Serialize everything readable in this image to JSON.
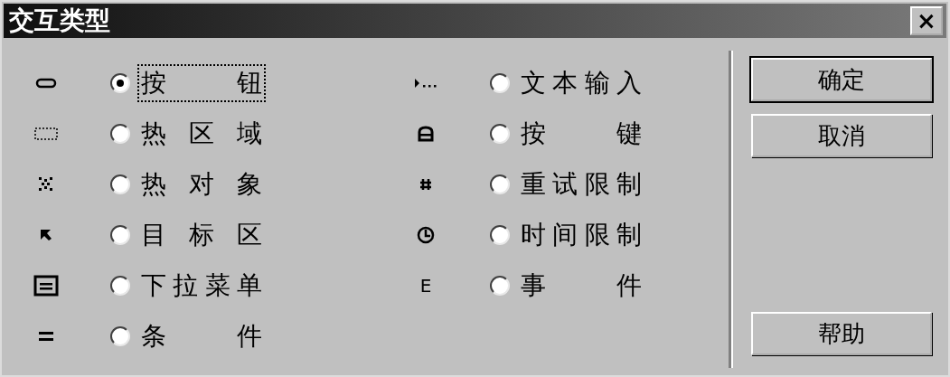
{
  "window": {
    "title": "交互类型",
    "close": "×"
  },
  "options": [
    {
      "kind": "button",
      "label": "按 钮",
      "selected": true
    },
    {
      "kind": "hotspot",
      "label": "热 区 域",
      "selected": false
    },
    {
      "kind": "hot-object",
      "label": "热 对 象",
      "selected": false
    },
    {
      "kind": "target-area",
      "label": "目 标 区",
      "selected": false
    },
    {
      "kind": "pulldown",
      "label": "下拉菜单",
      "selected": false
    },
    {
      "kind": "condition",
      "label": "条 件",
      "selected": false
    },
    {
      "kind": "text-entry",
      "label": "文本输入",
      "selected": false
    },
    {
      "kind": "keypress",
      "label": "按 键",
      "selected": false
    },
    {
      "kind": "tries",
      "label": "重试限制",
      "selected": false
    },
    {
      "kind": "time",
      "label": "时间限制",
      "selected": false
    },
    {
      "kind": "event",
      "label": "事 件",
      "selected": false,
      "icon_text": "E"
    }
  ],
  "buttons": [
    {
      "label": "确定",
      "kind": "default"
    },
    {
      "label": "取消",
      "kind": "normal"
    },
    {
      "label": "帮助",
      "kind": "bottom"
    }
  ]
}
